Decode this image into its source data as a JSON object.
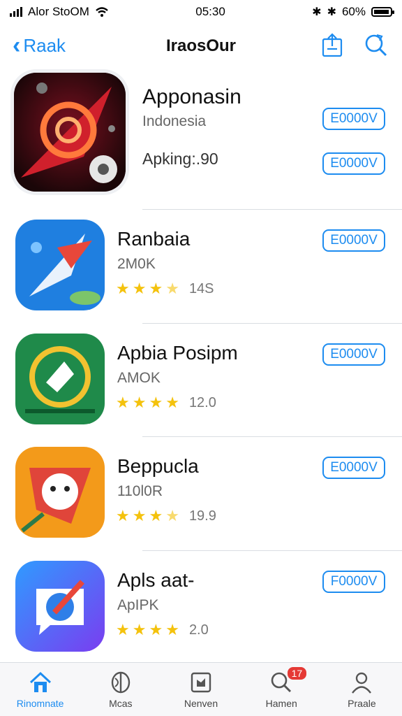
{
  "status_bar": {
    "carrier": "Alor StoOM",
    "time": "05:30",
    "battery": "60%"
  },
  "nav": {
    "back_label": "Raak",
    "title": "IraosOur"
  },
  "apps": [
    {
      "name": "Apponasin",
      "subtitle": "Indonesia",
      "extra": "Apking:.90",
      "button": "E0000V",
      "button2": "E0000V"
    },
    {
      "name": "Ranbaia",
      "subtitle": "2M0K",
      "rating_text": "14S",
      "button": "E0000V"
    },
    {
      "name": "Apbia Posipm",
      "subtitle": "AMOK",
      "rating_text": "12.0",
      "button": "E0000V"
    },
    {
      "name": "Beppucla",
      "subtitle": "110l0R",
      "rating_text": "19.9",
      "button": "E0000V"
    },
    {
      "name": "Apls aat-",
      "subtitle": "ApIPK",
      "rating_text": "2.0",
      "button": "F0000V"
    }
  ],
  "tabs": [
    {
      "label": "Rinomnate",
      "icon": "home-icon"
    },
    {
      "label": "Mcas",
      "icon": "layers-icon"
    },
    {
      "label": "Nenven",
      "icon": "store-icon"
    },
    {
      "label": "Hamen",
      "icon": "search-icon",
      "badge": "17"
    },
    {
      "label": "Praale",
      "icon": "profile-icon"
    }
  ],
  "colors": {
    "accent": "#1d8cf0",
    "star": "#f4c20d",
    "badge": "#e53935"
  }
}
